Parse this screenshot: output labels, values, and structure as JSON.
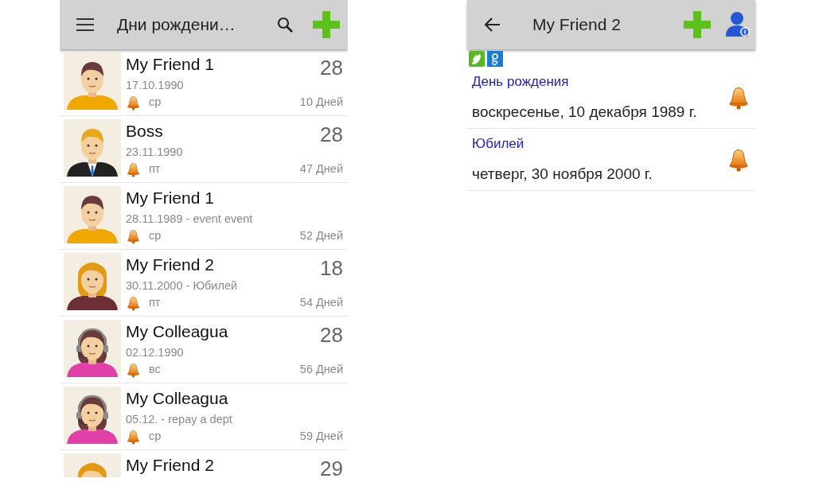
{
  "list_screen": {
    "title": "Дни рождени…",
    "contacts": [
      {
        "kind": "man",
        "name": "My Friend 1",
        "date": "17.10.1990",
        "weekday": "ср",
        "age": "28",
        "days": "10 Дней"
      },
      {
        "kind": "suit",
        "name": "Boss",
        "date": "23.11.1990",
        "weekday": "пт",
        "age": "28",
        "days": "47 Дней"
      },
      {
        "kind": "man",
        "name": "My Friend 1",
        "date": "28.11.1989 - event event",
        "weekday": "ср",
        "days": "52 Дней"
      },
      {
        "kind": "woman",
        "name": "My Friend 2",
        "date": "30.11.2000 - Юбилей",
        "weekday": "пт",
        "age": "18",
        "days": "54 Дней"
      },
      {
        "kind": "headset",
        "name": "My Colleagua",
        "date": "02.12.1990",
        "weekday": "вс",
        "age": "28",
        "days": "56 Дней"
      },
      {
        "kind": "headset",
        "name": "My Colleagua",
        "date": "05.12. - repay a dept",
        "weekday": "ср",
        "days": "59 Дней"
      },
      {
        "kind": "woman",
        "name": "My Friend 2",
        "age": "29"
      }
    ]
  },
  "detail_screen": {
    "title": "My Friend 2",
    "events": [
      {
        "label": "День рождения",
        "date": "воскресенье, 10 декабря 1989 г."
      },
      {
        "label": "Юбилей",
        "date": "четверг, 30 ноября 2000 г."
      }
    ]
  }
}
